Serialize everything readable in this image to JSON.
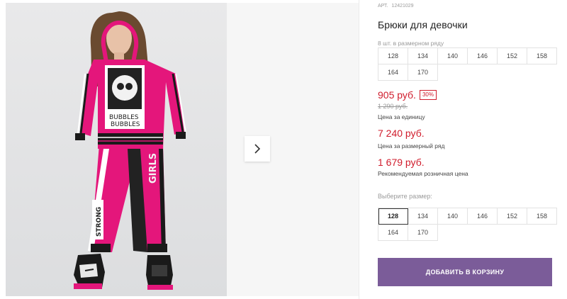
{
  "product": {
    "sku_label": "АРТ.",
    "sku": "12421029",
    "title": "Брюки для девочки"
  },
  "pack": {
    "note": "8 шт. в размерном ряду",
    "sizes_row1": [
      "128",
      "134",
      "140",
      "146",
      "152",
      "158"
    ],
    "sizes_row2": [
      "164",
      "170"
    ]
  },
  "pricing": {
    "price": "905 руб.",
    "discount": "30%",
    "old_price": "1 290 руб.",
    "unit_label": "Цена за единицу",
    "pack_price": "7 240 руб.",
    "pack_label": "Цена за размерный ряд",
    "rrp": "1 679 руб.",
    "rrp_label": "Рекомендуемая розничная цена",
    "accent_color": "#d01c2c"
  },
  "size_select": {
    "label": "Выберите размер:",
    "sizes_row1": [
      "128",
      "134",
      "140",
      "146",
      "152",
      "158"
    ],
    "sizes_row2": [
      "164",
      "170"
    ],
    "selected": "128"
  },
  "cart": {
    "button_label": "ДОБАВИТЬ В КОРЗИНУ",
    "button_color": "#7b5c99"
  },
  "gallery": {
    "next_icon": "chevron-right-icon",
    "photo_texts": {
      "hoodie_print": "BUBBLES",
      "legging_side": "GIRLS",
      "legging_patch": "STRONG"
    }
  }
}
